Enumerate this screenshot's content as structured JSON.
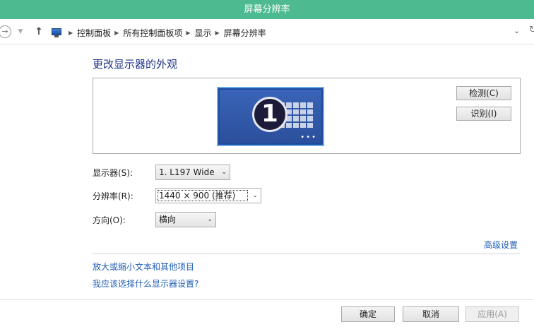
{
  "window": {
    "title": "屏幕分辨率"
  },
  "address": {
    "breadcrumbs": [
      "控制面板",
      "所有控制面板项",
      "显示",
      "屏幕分辨率"
    ],
    "icons": {
      "back": "back-arrow-icon",
      "forward": "forward-arrow-icon",
      "up": "up-arrow-icon",
      "location": "computer-icon",
      "dropdown": "chevron-down-icon",
      "refresh": "refresh-icon"
    }
  },
  "main": {
    "heading": "更改显示器的外观",
    "preview": {
      "monitor_number": "1",
      "detect_label": "检测(C)",
      "identify_label": "识别(I)",
      "monitor_dots": "•••"
    },
    "settings": {
      "display": {
        "label": "显示器(S):",
        "value": "1. L197 Wide"
      },
      "resolution": {
        "label": "分辨率(R):",
        "value": "1440 × 900 (推荐)"
      },
      "orientation": {
        "label": "方向(O):",
        "value": "横向"
      }
    },
    "advanced_link": "高级设置",
    "links": {
      "text_size": "放大或缩小文本和其他项目",
      "which_settings": "我应该选择什么显示器设置?"
    }
  },
  "footer": {
    "ok_label": "确定",
    "cancel_label": "取消",
    "apply_label": "应用(A)"
  },
  "colors": {
    "titlebar": "#4dba8f",
    "link": "#1e5db5",
    "heading": "#1e3287",
    "monitor": "#1a4aa0"
  }
}
